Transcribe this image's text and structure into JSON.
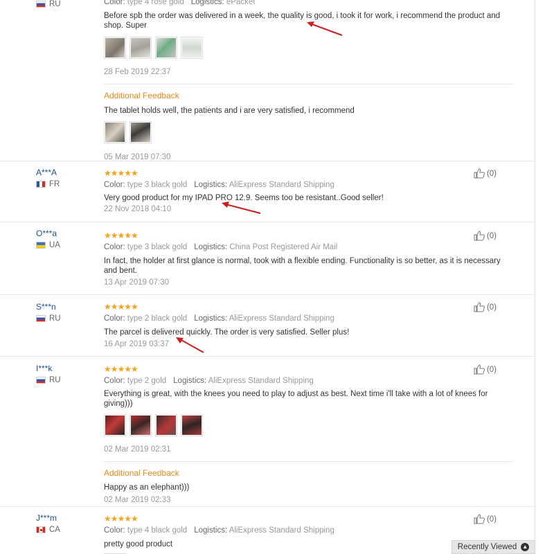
{
  "reviews": [
    {
      "country": "RU",
      "color_label": "Color:",
      "color_value": "type 4 rose gold",
      "logistics_label": "Logistics:",
      "logistics_value": "ePacket",
      "text_line1": "Before spb the order was delivered in a week, the quality is good, i took it for work, i recommend the product and",
      "text_line2": "shop. Super",
      "date": "28 Feb 2019 22:37",
      "additional_title": "Additional Feedback",
      "additional_text": "The tablet holds well, the patients and i are very satisfied, i recommend",
      "additional_date": "05 Mar 2019 07:30"
    },
    {
      "buyer": "A***A",
      "country": "FR",
      "stars": "★★★★★",
      "color_label": "Color:",
      "color_value": "type 3 black gold",
      "logistics_label": "Logistics:",
      "logistics_value": "AliExpress Standard Shipping",
      "text": "Very good product for my IPAD PRO 12.9. Seems too be resistant..Good seller!",
      "date": "22 Nov 2018 04:10",
      "helpful": "(0)"
    },
    {
      "buyer": "O***a",
      "country": "UA",
      "stars": "★★★★★",
      "color_label": "Color:",
      "color_value": "type 3 black gold",
      "logistics_label": "Logistics:",
      "logistics_value": "China Post Registered Air Mail",
      "text_line1": "In fact, the holder at first glance is normal, took with a flexible ending. Functionality is so better, as it is necessary",
      "text_line2": "and bent.",
      "date": "13 Apr 2019 07:30",
      "helpful": "(0)"
    },
    {
      "buyer": "S***n",
      "country": "RU",
      "stars": "★★★★★",
      "color_label": "Color:",
      "color_value": "type 2 black gold",
      "logistics_label": "Logistics:",
      "logistics_value": "AliExpress Standard Shipping",
      "text": "The parcel is delivered quickly. The order is very satisfied. Seller plus!",
      "date": "16 Apr 2019 03:37",
      "helpful": "(0)"
    },
    {
      "buyer": "I***k",
      "country": "RU",
      "stars": "★★★★★",
      "color_label": "Color:",
      "color_value": "type 2 gold",
      "logistics_label": "Logistics:",
      "logistics_value": "AliExpress Standard Shipping",
      "text_line1": "Everything is great, with the knees you need to play to adjust as best. Next time i'll take with a lot of knees for",
      "text_line2": "giving)))",
      "date": "02 Mar 2019 02:31",
      "additional_title": "Additional Feedback",
      "additional_text": "Happy as an elephant)))",
      "additional_date": "02 Mar 2019 02:33",
      "helpful": "(0)"
    },
    {
      "buyer": "J***m",
      "country": "CA",
      "stars": "★★★★★",
      "color_label": "Color:",
      "color_value": "type 4 black gold",
      "logistics_label": "Logistics:",
      "logistics_value": "AliExpress Standard Shipping",
      "text": "pretty good product",
      "helpful": "(0)"
    }
  ],
  "recently_viewed": {
    "label": "Recently Viewed",
    "icon": "chevron-up-icon"
  },
  "colors": {
    "star": "#f5a31a",
    "buyer_link": "#1f4f8c",
    "additional_feedback": "#e5871a",
    "annotation_arrow": "#cc1f1f"
  }
}
